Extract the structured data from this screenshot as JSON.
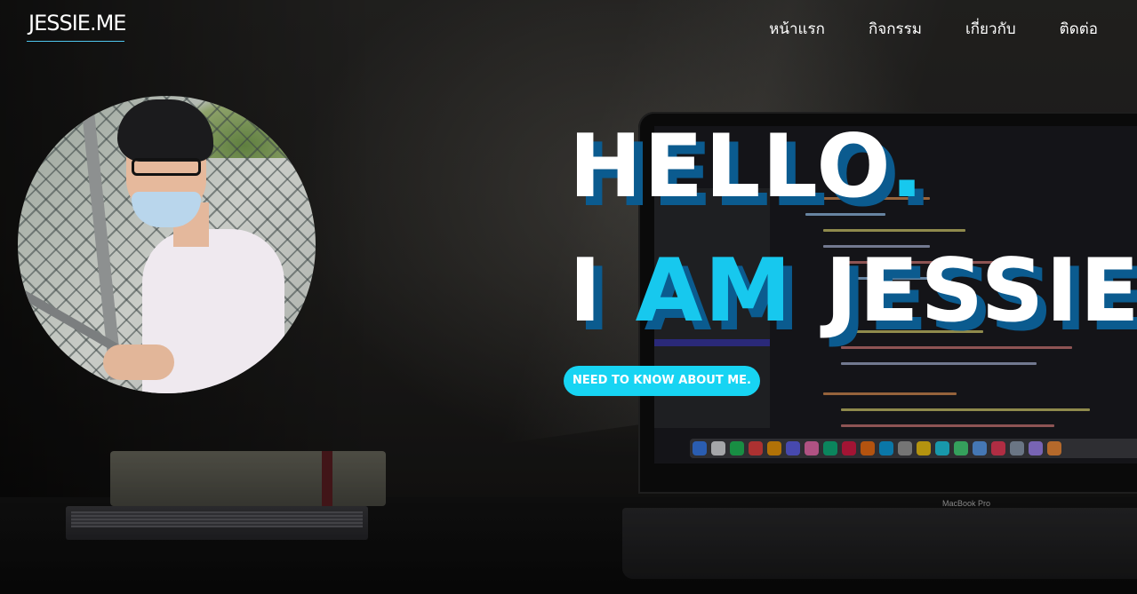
{
  "header": {
    "logo": "JESSIE.ME"
  },
  "nav": {
    "items": [
      "หน้าแรก",
      "กิจกรรม",
      "เกี่ยวกับ",
      "ติดต่อ"
    ]
  },
  "hero": {
    "line1_text": "HELLO",
    "line1_dot": ".",
    "line2_prefix": "I",
    "line2_accent": "AM",
    "line2_name": "JESSIE",
    "line2_dot": ".",
    "cta_label": "NEED TO KNOW ABOUT ME."
  },
  "background": {
    "laptop_label": "MacBook Pro"
  },
  "colors": {
    "accent": "#17c8ee",
    "shadow": "#0b5b8f",
    "text": "#ffffff",
    "cta_bg": "#17d4f3"
  }
}
